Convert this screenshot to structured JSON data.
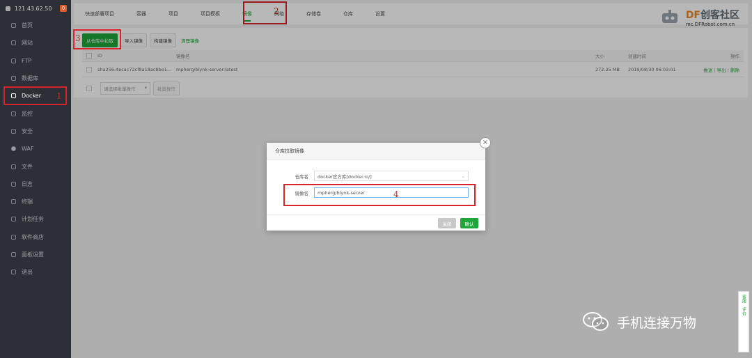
{
  "sidebar": {
    "ip": "121.43.62.50",
    "badge": "0",
    "items": [
      {
        "label": "首页",
        "icon": "home-icon"
      },
      {
        "label": "网站",
        "icon": "globe-icon"
      },
      {
        "label": "FTP",
        "icon": "ftp-icon"
      },
      {
        "label": "数据库",
        "icon": "database-icon"
      },
      {
        "label": "Docker",
        "icon": "docker-icon"
      },
      {
        "label": "监控",
        "icon": "monitor-icon"
      },
      {
        "label": "安全",
        "icon": "shield-icon"
      },
      {
        "label": "WAF",
        "icon": "waf-icon"
      },
      {
        "label": "文件",
        "icon": "folder-icon"
      },
      {
        "label": "日志",
        "icon": "log-icon"
      },
      {
        "label": "终端",
        "icon": "terminal-icon"
      },
      {
        "label": "计划任务",
        "icon": "calendar-icon"
      },
      {
        "label": "软件商店",
        "icon": "store-icon"
      },
      {
        "label": "面板设置",
        "icon": "settings-icon"
      },
      {
        "label": "退出",
        "icon": "logout-icon"
      }
    ],
    "active_index": 4
  },
  "tabs": [
    "快速部署项目",
    "容器",
    "项目",
    "项目模板",
    "镜像",
    "网络",
    "存储卷",
    "仓库",
    "设置"
  ],
  "active_tab": 4,
  "annotations": {
    "a1": "1",
    "a2": "2",
    "a3": "3",
    "a4": "4"
  },
  "watermark": {
    "brand_df": "DF",
    "brand_rest": "创客社区",
    "site": "mc.DFRobot.com.cn"
  },
  "toolbar": {
    "pull_label": "从仓库中拉取",
    "import_label": "导入镜像",
    "build_label": "构建镜像",
    "clean_label": "清理镜像"
  },
  "table": {
    "headers": {
      "id": "ID",
      "name": "镜像名",
      "size": "大小",
      "time": "创建时间",
      "op": "操作"
    },
    "rows": [
      {
        "id": "sha256:4ecac72cf8a18ac8be1...",
        "name": "mpherg/blynk-server:latest",
        "size": "272.25 MB",
        "time": "2019/08/30 06:03:01",
        "op_push": "推送",
        "op_export": "导出",
        "op_delete": "删除"
      }
    ],
    "batch_placeholder": "请选择批量操作",
    "batch_button": "批量操作"
  },
  "dialog": {
    "title": "仓库拉取镜像",
    "repo_label": "仓库名",
    "repo_value": "docker官方库[docker.io/]",
    "image_label": "镜像名",
    "image_value": "mpherg/blynk-server",
    "cancel_label": "关闭",
    "ok_label": "确认"
  },
  "float": {
    "service": "客服",
    "review": "评价"
  },
  "wechat_caption": "手机连接万物",
  "colors": {
    "accent": "#20a53a",
    "annotation": "#d8232a",
    "sidebar": "#2c2f35"
  }
}
